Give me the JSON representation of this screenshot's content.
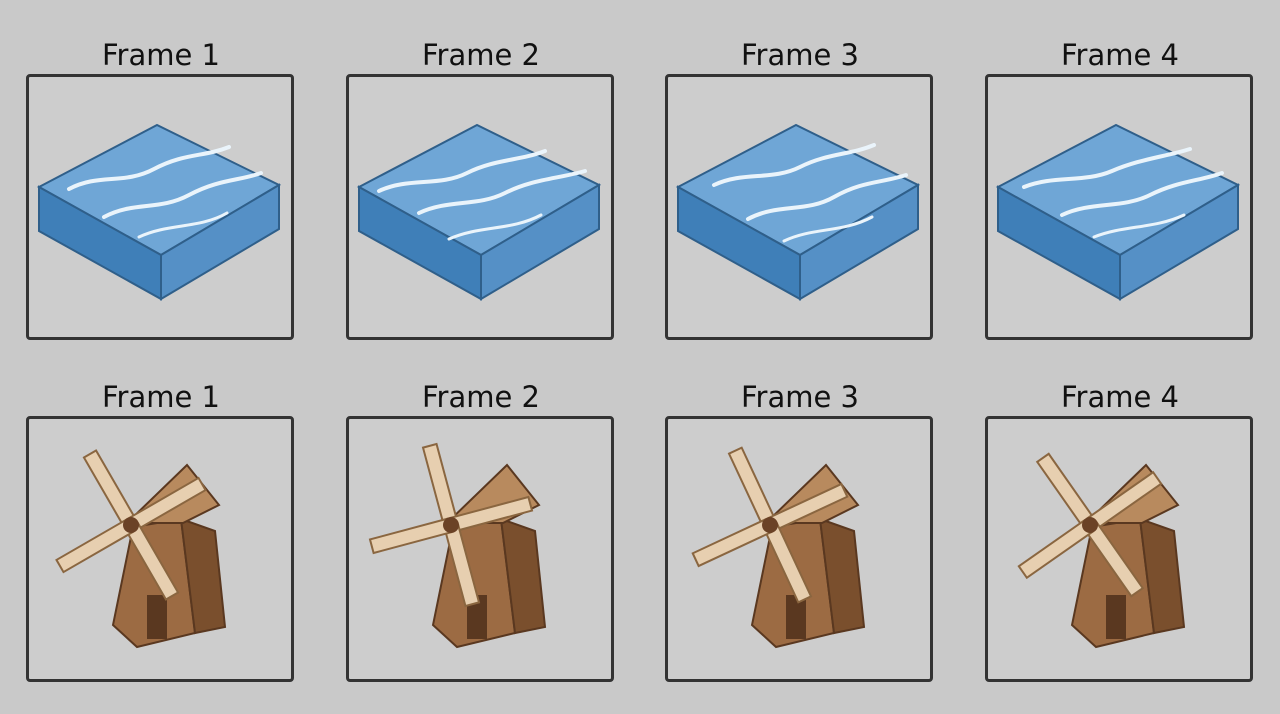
{
  "rows": [
    {
      "name": "water-tile",
      "frames": [
        {
          "label": "Frame 1"
        },
        {
          "label": "Frame 2"
        },
        {
          "label": "Frame 3"
        },
        {
          "label": "Frame 4"
        }
      ]
    },
    {
      "name": "windmill",
      "frames": [
        {
          "label": "Frame 1"
        },
        {
          "label": "Frame 2"
        },
        {
          "label": "Frame 3"
        },
        {
          "label": "Frame 4"
        }
      ]
    }
  ],
  "colors": {
    "background": "#c9c9c9",
    "frame_border": "#333333",
    "water_top": "#6fa6d6",
    "water_side": "#3f7fb8",
    "water_highlight": "#eaf4fb",
    "wood_light": "#c9a27a",
    "wood_mid": "#9c6b43",
    "wood_dark": "#6b4226",
    "blade": "#e7cfb0"
  }
}
